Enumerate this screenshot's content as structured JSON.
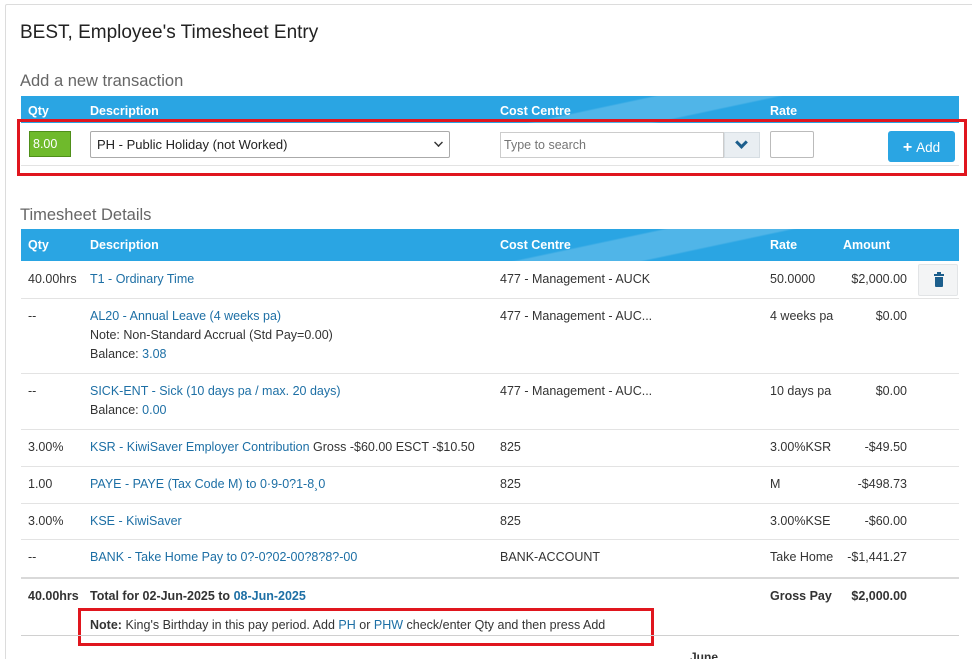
{
  "page": {
    "title": "BEST, Employee's Timesheet Entry"
  },
  "new_transaction": {
    "section_title": "Add a new transaction",
    "headers": {
      "qty": "Qty",
      "description": "Description",
      "cost_centre": "Cost Centre",
      "rate": "Rate"
    },
    "qty_value": "8.00",
    "description_selected": "PH - Public Holiday (not Worked)",
    "cost_centre_placeholder": "Type to search",
    "rate_value": "",
    "add_label": "Add"
  },
  "details": {
    "section_title": "Timesheet Details",
    "headers": {
      "qty": "Qty",
      "description": "Description",
      "cost_centre": "Cost Centre",
      "rate": "Rate",
      "amount": "Amount"
    },
    "rows": [
      {
        "qty": "40.00hrs",
        "desc": "T1 - Ordinary Time",
        "cc": "477 - Management - AUCK",
        "rate": "50.0000",
        "amount": "$2,000.00"
      },
      {
        "qty": "--",
        "desc": "AL20 - Annual Leave (4 weeks pa)",
        "note": "Note: Non-Standard Accrual (Std Pay=0.00)",
        "balance_label": "Balance:",
        "balance_value": "3.08",
        "cc": "477 - Management - AUC...",
        "rate": "4 weeks pa",
        "amount": "$0.00"
      },
      {
        "qty": "--",
        "desc": "SICK-ENT - Sick (10 days pa / max. 20 days)",
        "balance_label": "Balance:",
        "balance_value": "0.00",
        "cc": "477 - Management - AUC...",
        "rate": "10 days pa",
        "amount": "$0.00"
      },
      {
        "qty": "3.00%",
        "desc": "KSR - KiwiSaver Employer Contribution",
        "desc_extra": "Gross -$60.00 ESCT -$10.50",
        "cc": "825",
        "rate": "3.00%KSR",
        "amount": "-$49.50"
      },
      {
        "qty": "1.00",
        "desc": "PAYE - PAYE (Tax Code M) to 0·9-0?1-8¸0",
        "cc": "825",
        "rate": "M",
        "amount": "-$498.73"
      },
      {
        "qty": "3.00%",
        "desc": "KSE - KiwiSaver",
        "cc": "825",
        "rate": "3.00%KSE",
        "amount": "-$60.00"
      },
      {
        "qty": "--",
        "desc": "BANK - Take Home Pay to 0?-0?02-00?8?8?-00",
        "cc": "BANK-ACCOUNT",
        "rate": "Take Home",
        "amount": "-$1,441.27"
      }
    ],
    "total": {
      "qty": "40.00hrs",
      "label": "Total for 02-Jun-2025 to",
      "end_date": "08-Jun-2025",
      "gross_label": "Gross Pay",
      "gross_value": "$2,000.00"
    }
  },
  "note": {
    "label": "Note:",
    "text_before": "King's Birthday in this pay period. Add",
    "link1": "PH",
    "or": "or",
    "link2": "PHW",
    "text_after": "check/enter Qty and then press Add"
  },
  "footer": {
    "partial_text": "June"
  },
  "colors": {
    "header_blue": "#2aa5e3",
    "link_blue": "#1d6fa5",
    "qty_green": "#6fba2c",
    "highlight_red": "#e0161e"
  },
  "icons": [
    "plus-icon",
    "chevron-down-icon",
    "trash-icon"
  ]
}
